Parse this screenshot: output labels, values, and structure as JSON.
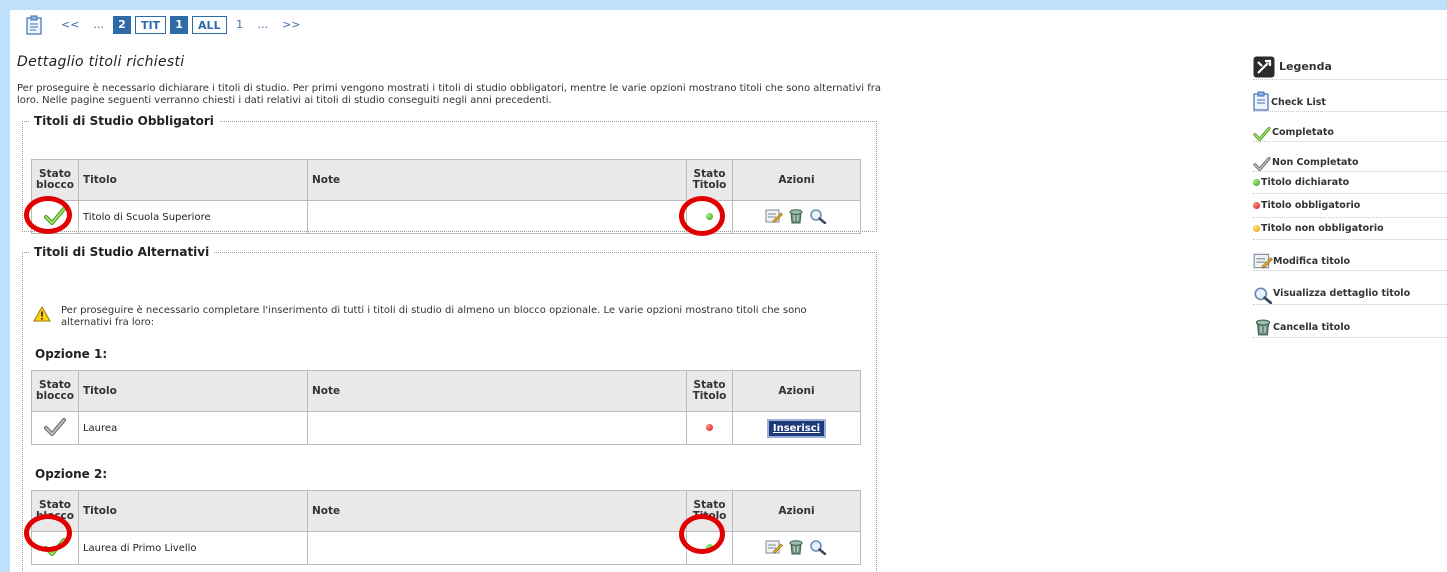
{
  "pagination": {
    "first": "<<",
    "ellipsis1": "...",
    "page_prev": "2",
    "tit": "TIT",
    "current": "1",
    "all": "ALL",
    "page_next": "1",
    "ellipsis2": "...",
    "last": ">>"
  },
  "page_title": "Dettaglio titoli richiesti",
  "intro": "Per proseguire è necessario dichiarare i titoli di studio. Per primi vengono mostrati i titoli di studio obbligatori, mentre le varie opzioni mostrano titoli che sono alternativi fra loro. Nelle pagine seguenti verranno chiesti i dati relativi ai titoli di studio conseguiti negli anni precedenti.",
  "table_headers": {
    "stato_blocco": "Stato blocco",
    "titolo": "Titolo",
    "note": "Note",
    "stato_titolo": "Stato Titolo",
    "azioni": "Azioni"
  },
  "sect_obbligatori": {
    "legend": "Titoli di Studio Obbligatori",
    "row": {
      "titolo": "Titolo di Scuola Superiore",
      "note": "",
      "block_status": "completato",
      "title_status": "green"
    }
  },
  "sect_alternativi": {
    "legend": "Titoli di Studio Alternativi",
    "warning": "Per proseguire è necessario completare l'inserimento di tutti i titoli di studio di almeno un blocco opzionale. Le varie opzioni mostrano titoli che sono alternativi fra loro:",
    "options": [
      {
        "title": "Opzione 1:",
        "row": {
          "titolo": "Laurea",
          "note": "",
          "block_status": "non-completato",
          "title_status": "red",
          "action_label": "Inserisci"
        }
      },
      {
        "title": "Opzione 2:",
        "row": {
          "titolo": "Laurea di Primo Livello",
          "note": "",
          "block_status": "completato",
          "title_status": "green"
        }
      }
    ]
  },
  "legend": {
    "title": "Legenda",
    "items": [
      {
        "icon": "checklist-icon",
        "label": "Check List"
      },
      {
        "icon": "green-check-icon",
        "label": "Completato"
      },
      {
        "icon": "gray-check-icon",
        "label": "Non Completato"
      },
      {
        "icon": "green-dot-icon",
        "label": "Titolo dichiarato"
      },
      {
        "icon": "red-dot-icon",
        "label": "Titolo obbligatorio"
      },
      {
        "icon": "yellow-dot-icon",
        "label": "Titolo non obbligatorio"
      },
      {
        "icon": "edit-icon",
        "label": "Modifica titolo"
      },
      {
        "icon": "magnifier-icon",
        "label": "Visualizza dettaglio titolo"
      },
      {
        "icon": "delete-icon",
        "label": "Cancella titolo"
      }
    ]
  },
  "colors": {
    "background_border": "#bfe0fb",
    "pagination_blue": "#2f6aa8",
    "highlight_ring": "#e00000",
    "status_green": "#2b9a17",
    "status_red": "#d01515",
    "status_yellow": "#e3a30a",
    "inserisci_bg": "#1f3a7a"
  }
}
